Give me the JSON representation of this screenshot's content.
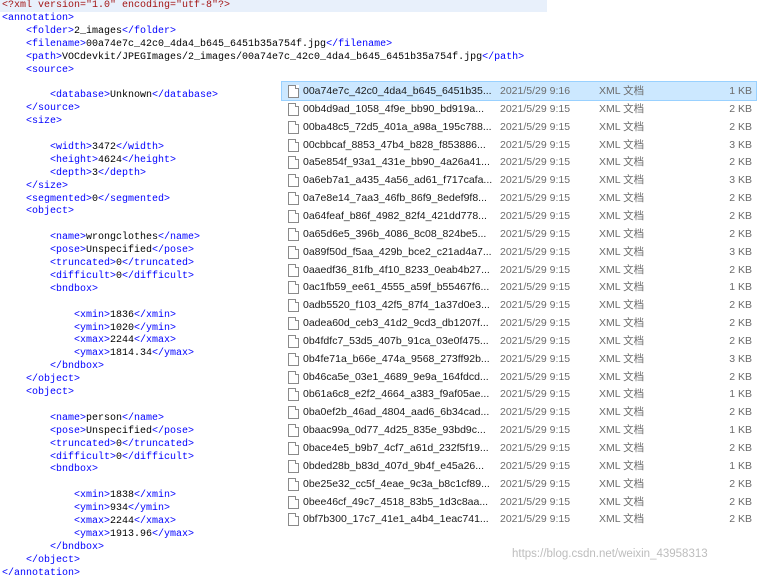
{
  "xml_lines": [
    {
      "indent": 0,
      "parts": [
        {
          "c": "pi",
          "t": "<?xml version=\"1.0\" encoding=\"utf-8\"?>"
        }
      ]
    },
    {
      "indent": 0,
      "parts": [
        {
          "c": "tag",
          "t": "<annotation>"
        }
      ]
    },
    {
      "indent": 1,
      "parts": [
        {
          "c": "tag",
          "t": "<folder>"
        },
        {
          "c": "txt",
          "t": "2_images"
        },
        {
          "c": "tag",
          "t": "</folder>"
        }
      ]
    },
    {
      "indent": 1,
      "parts": [
        {
          "c": "tag",
          "t": "<filename>"
        },
        {
          "c": "txt",
          "t": "00a74e7c_42c0_4da4_b645_6451b35a754f.jpg"
        },
        {
          "c": "tag",
          "t": "</filename>"
        }
      ]
    },
    {
      "indent": 1,
      "parts": [
        {
          "c": "tag",
          "t": "<path>"
        },
        {
          "c": "txt",
          "t": "VOCdevkit/JPEGImages/2_images/00a74e7c_42c0_4da4_b645_6451b35a754f.jpg"
        },
        {
          "c": "tag",
          "t": "</path>"
        }
      ]
    },
    {
      "indent": 1,
      "parts": [
        {
          "c": "tag",
          "t": "<source>"
        }
      ]
    },
    {
      "indent": 0,
      "parts": []
    },
    {
      "indent": 2,
      "parts": [
        {
          "c": "tag",
          "t": "<database>"
        },
        {
          "c": "txt",
          "t": "Unknown"
        },
        {
          "c": "tag",
          "t": "</database>"
        }
      ]
    },
    {
      "indent": 1,
      "parts": [
        {
          "c": "tag",
          "t": "</source>"
        }
      ]
    },
    {
      "indent": 1,
      "parts": [
        {
          "c": "tag",
          "t": "<size>"
        }
      ]
    },
    {
      "indent": 0,
      "parts": []
    },
    {
      "indent": 2,
      "parts": [
        {
          "c": "tag",
          "t": "<width>"
        },
        {
          "c": "txt",
          "t": "3472"
        },
        {
          "c": "tag",
          "t": "</width>"
        }
      ]
    },
    {
      "indent": 2,
      "parts": [
        {
          "c": "tag",
          "t": "<height>"
        },
        {
          "c": "txt",
          "t": "4624"
        },
        {
          "c": "tag",
          "t": "</height>"
        }
      ]
    },
    {
      "indent": 2,
      "parts": [
        {
          "c": "tag",
          "t": "<depth>"
        },
        {
          "c": "txt",
          "t": "3"
        },
        {
          "c": "tag",
          "t": "</depth>"
        }
      ]
    },
    {
      "indent": 1,
      "parts": [
        {
          "c": "tag",
          "t": "</size>"
        }
      ]
    },
    {
      "indent": 1,
      "parts": [
        {
          "c": "tag",
          "t": "<segmented>"
        },
        {
          "c": "txt",
          "t": "0"
        },
        {
          "c": "tag",
          "t": "</segmented>"
        }
      ]
    },
    {
      "indent": 1,
      "parts": [
        {
          "c": "tag",
          "t": "<object>"
        }
      ]
    },
    {
      "indent": 0,
      "parts": []
    },
    {
      "indent": 2,
      "parts": [
        {
          "c": "tag",
          "t": "<name>"
        },
        {
          "c": "txt",
          "t": "wrongclothes"
        },
        {
          "c": "tag",
          "t": "</name>"
        }
      ]
    },
    {
      "indent": 2,
      "parts": [
        {
          "c": "tag",
          "t": "<pose>"
        },
        {
          "c": "txt",
          "t": "Unspecified"
        },
        {
          "c": "tag",
          "t": "</pose>"
        }
      ]
    },
    {
      "indent": 2,
      "parts": [
        {
          "c": "tag",
          "t": "<truncated>"
        },
        {
          "c": "txt",
          "t": "0"
        },
        {
          "c": "tag",
          "t": "</truncated>"
        }
      ]
    },
    {
      "indent": 2,
      "parts": [
        {
          "c": "tag",
          "t": "<difficult>"
        },
        {
          "c": "txt",
          "t": "0"
        },
        {
          "c": "tag",
          "t": "</difficult>"
        }
      ]
    },
    {
      "indent": 2,
      "parts": [
        {
          "c": "tag",
          "t": "<bndbox>"
        }
      ]
    },
    {
      "indent": 0,
      "parts": []
    },
    {
      "indent": 3,
      "parts": [
        {
          "c": "tag",
          "t": "<xmin>"
        },
        {
          "c": "txt",
          "t": "1836"
        },
        {
          "c": "tag",
          "t": "</xmin>"
        }
      ]
    },
    {
      "indent": 3,
      "parts": [
        {
          "c": "tag",
          "t": "<ymin>"
        },
        {
          "c": "txt",
          "t": "1020"
        },
        {
          "c": "tag",
          "t": "</ymin>"
        }
      ]
    },
    {
      "indent": 3,
      "parts": [
        {
          "c": "tag",
          "t": "<xmax>"
        },
        {
          "c": "txt",
          "t": "2244"
        },
        {
          "c": "tag",
          "t": "</xmax>"
        }
      ]
    },
    {
      "indent": 3,
      "parts": [
        {
          "c": "tag",
          "t": "<ymax>"
        },
        {
          "c": "txt",
          "t": "1814.34"
        },
        {
          "c": "tag",
          "t": "</ymax>"
        }
      ]
    },
    {
      "indent": 2,
      "parts": [
        {
          "c": "tag",
          "t": "</bndbox>"
        }
      ]
    },
    {
      "indent": 1,
      "parts": [
        {
          "c": "tag",
          "t": "</object>"
        }
      ]
    },
    {
      "indent": 1,
      "parts": [
        {
          "c": "tag",
          "t": "<object>"
        }
      ]
    },
    {
      "indent": 0,
      "parts": []
    },
    {
      "indent": 2,
      "parts": [
        {
          "c": "tag",
          "t": "<name>"
        },
        {
          "c": "txt",
          "t": "person"
        },
        {
          "c": "tag",
          "t": "</name>"
        }
      ]
    },
    {
      "indent": 2,
      "parts": [
        {
          "c": "tag",
          "t": "<pose>"
        },
        {
          "c": "txt",
          "t": "Unspecified"
        },
        {
          "c": "tag",
          "t": "</pose>"
        }
      ]
    },
    {
      "indent": 2,
      "parts": [
        {
          "c": "tag",
          "t": "<truncated>"
        },
        {
          "c": "txt",
          "t": "0"
        },
        {
          "c": "tag",
          "t": "</truncated>"
        }
      ]
    },
    {
      "indent": 2,
      "parts": [
        {
          "c": "tag",
          "t": "<difficult>"
        },
        {
          "c": "txt",
          "t": "0"
        },
        {
          "c": "tag",
          "t": "</difficult>"
        }
      ]
    },
    {
      "indent": 2,
      "parts": [
        {
          "c": "tag",
          "t": "<bndbox>"
        }
      ]
    },
    {
      "indent": 0,
      "parts": []
    },
    {
      "indent": 3,
      "parts": [
        {
          "c": "tag",
          "t": "<xmin>"
        },
        {
          "c": "txt",
          "t": "1838"
        },
        {
          "c": "tag",
          "t": "</xmin>"
        }
      ]
    },
    {
      "indent": 3,
      "parts": [
        {
          "c": "tag",
          "t": "<ymin>"
        },
        {
          "c": "txt",
          "t": "934"
        },
        {
          "c": "tag",
          "t": "</ymin>"
        }
      ]
    },
    {
      "indent": 3,
      "parts": [
        {
          "c": "tag",
          "t": "<xmax>"
        },
        {
          "c": "txt",
          "t": "2244"
        },
        {
          "c": "tag",
          "t": "</xmax>"
        }
      ]
    },
    {
      "indent": 3,
      "parts": [
        {
          "c": "tag",
          "t": "<ymax>"
        },
        {
          "c": "txt",
          "t": "1913.96"
        },
        {
          "c": "tag",
          "t": "</ymax>"
        }
      ]
    },
    {
      "indent": 2,
      "parts": [
        {
          "c": "tag",
          "t": "</bndbox>"
        }
      ]
    },
    {
      "indent": 1,
      "parts": [
        {
          "c": "tag",
          "t": "</object>"
        }
      ]
    },
    {
      "indent": 0,
      "parts": [
        {
          "c": "tag",
          "t": "</annotation>"
        }
      ]
    }
  ],
  "files": [
    {
      "name": "00a74e7c_42c0_4da4_b645_6451b35...",
      "date": "2021/5/29 9:16",
      "type": "XML 文档",
      "size": "1 KB",
      "selected": true
    },
    {
      "name": "00b4d9ad_1058_4f9e_bb90_bd919a...",
      "date": "2021/5/29 9:15",
      "type": "XML 文档",
      "size": "2 KB"
    },
    {
      "name": "00ba48c5_72d5_401a_a98a_195c788...",
      "date": "2021/5/29 9:15",
      "type": "XML 文档",
      "size": "2 KB"
    },
    {
      "name": "00cbbcaf_8853_47b4_b828_f853886...",
      "date": "2021/5/29 9:15",
      "type": "XML 文档",
      "size": "3 KB"
    },
    {
      "name": "0a5e854f_93a1_431e_bb90_4a26a41...",
      "date": "2021/5/29 9:15",
      "type": "XML 文档",
      "size": "2 KB"
    },
    {
      "name": "0a6eb7a1_a435_4a56_ad61_f717cafa...",
      "date": "2021/5/29 9:15",
      "type": "XML 文档",
      "size": "3 KB"
    },
    {
      "name": "0a7e8e14_7aa3_46fb_86f9_8edef9f8...",
      "date": "2021/5/29 9:15",
      "type": "XML 文档",
      "size": "2 KB"
    },
    {
      "name": "0a64feaf_b86f_4982_82f4_421dd778...",
      "date": "2021/5/29 9:15",
      "type": "XML 文档",
      "size": "2 KB"
    },
    {
      "name": "0a65d6e5_396b_4086_8c08_824be5...",
      "date": "2021/5/29 9:15",
      "type": "XML 文档",
      "size": "2 KB"
    },
    {
      "name": "0a89f50d_f5aa_429b_bce2_c21ad4a7...",
      "date": "2021/5/29 9:15",
      "type": "XML 文档",
      "size": "3 KB"
    },
    {
      "name": "0aaedf36_81fb_4f10_8233_0eab4b27...",
      "date": "2021/5/29 9:15",
      "type": "XML 文档",
      "size": "2 KB"
    },
    {
      "name": "0ac1fb59_ee61_4555_a59f_b55467f6...",
      "date": "2021/5/29 9:15",
      "type": "XML 文档",
      "size": "1 KB"
    },
    {
      "name": "0adb5520_f103_42f5_87f4_1a37d0e3...",
      "date": "2021/5/29 9:15",
      "type": "XML 文档",
      "size": "2 KB"
    },
    {
      "name": "0adea60d_ceb3_41d2_9cd3_db1207f...",
      "date": "2021/5/29 9:15",
      "type": "XML 文档",
      "size": "2 KB"
    },
    {
      "name": "0b4fdfc7_53d5_407b_91ca_03e0f475...",
      "date": "2021/5/29 9:15",
      "type": "XML 文档",
      "size": "2 KB"
    },
    {
      "name": "0b4fe71a_b66e_474a_9568_273ff92b...",
      "date": "2021/5/29 9:15",
      "type": "XML 文档",
      "size": "3 KB"
    },
    {
      "name": "0b46ca5e_03e1_4689_9e9a_164fdcd...",
      "date": "2021/5/29 9:15",
      "type": "XML 文档",
      "size": "2 KB"
    },
    {
      "name": "0b61a6c8_e2f2_4664_a383_f9af05ae...",
      "date": "2021/5/29 9:15",
      "type": "XML 文档",
      "size": "1 KB"
    },
    {
      "name": "0ba0ef2b_46ad_4804_aad6_6b34cad...",
      "date": "2021/5/29 9:15",
      "type": "XML 文档",
      "size": "2 KB"
    },
    {
      "name": "0baac99a_0d77_4d25_835e_93bd9c...",
      "date": "2021/5/29 9:15",
      "type": "XML 文档",
      "size": "1 KB"
    },
    {
      "name": "0bace4e5_b9b7_4cf7_a61d_232f5f19...",
      "date": "2021/5/29 9:15",
      "type": "XML 文档",
      "size": "2 KB"
    },
    {
      "name": "0bded28b_b83d_407d_9b4f_e45a26...",
      "date": "2021/5/29 9:15",
      "type": "XML 文档",
      "size": "1 KB"
    },
    {
      "name": "0be25e32_cc5f_4eae_9c3a_b8c1cf89...",
      "date": "2021/5/29 9:15",
      "type": "XML 文档",
      "size": "2 KB"
    },
    {
      "name": "0bee46cf_49c7_4518_83b5_1d3c8aa...",
      "date": "2021/5/29 9:15",
      "type": "XML 文档",
      "size": "2 KB"
    },
    {
      "name": "0bf7b300_17c7_41e1_a4b4_1eac741...",
      "date": "2021/5/29 9:15",
      "type": "XML 文档",
      "size": "2 KB"
    }
  ],
  "watermark": "https://blog.csdn.net/weixin_43958313"
}
